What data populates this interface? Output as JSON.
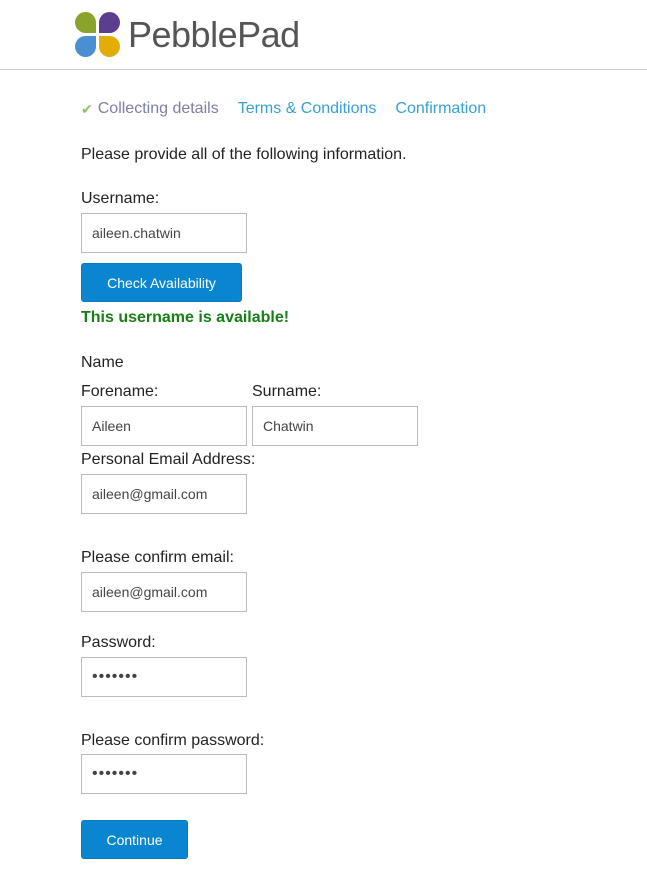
{
  "header": {
    "brand": "PebblePad",
    "logo_colors": {
      "top_left": "#8aa32b",
      "top_right": "#5b3f8e",
      "bottom_left": "#4a8fd1",
      "bottom_right": "#e1ad06"
    }
  },
  "steps": [
    {
      "label": "Collecting details",
      "icon": "checkmark-icon",
      "state": "current"
    },
    {
      "label": "Terms & Conditions",
      "state": "link"
    },
    {
      "label": "Confirmation",
      "state": "link"
    }
  ],
  "intro": "Please provide all of the following information.",
  "form": {
    "username_label": "Username:",
    "username_value": "aileen.chatwin",
    "check_button": "Check Availability",
    "availability_message": "This username is available!",
    "name_heading": "Name",
    "forename_label": "Forename:",
    "forename_value": "Aileen",
    "surname_label": "Surname:",
    "surname_value": "Chatwin",
    "email_label": "Personal Email Address:",
    "email_value": "aileen@gmail.com",
    "confirm_email_label": "Please confirm email:",
    "confirm_email_value": "aileen@gmail.com",
    "password_label": "Password:",
    "password_value": "•••••••",
    "confirm_password_label": "Please confirm password:",
    "confirm_password_value": "•••••••",
    "continue_button": "Continue"
  },
  "colors": {
    "accent": "#0a86d1",
    "link": "#36a0d6",
    "current_step": "#7d7fa8",
    "success": "#167f16"
  }
}
